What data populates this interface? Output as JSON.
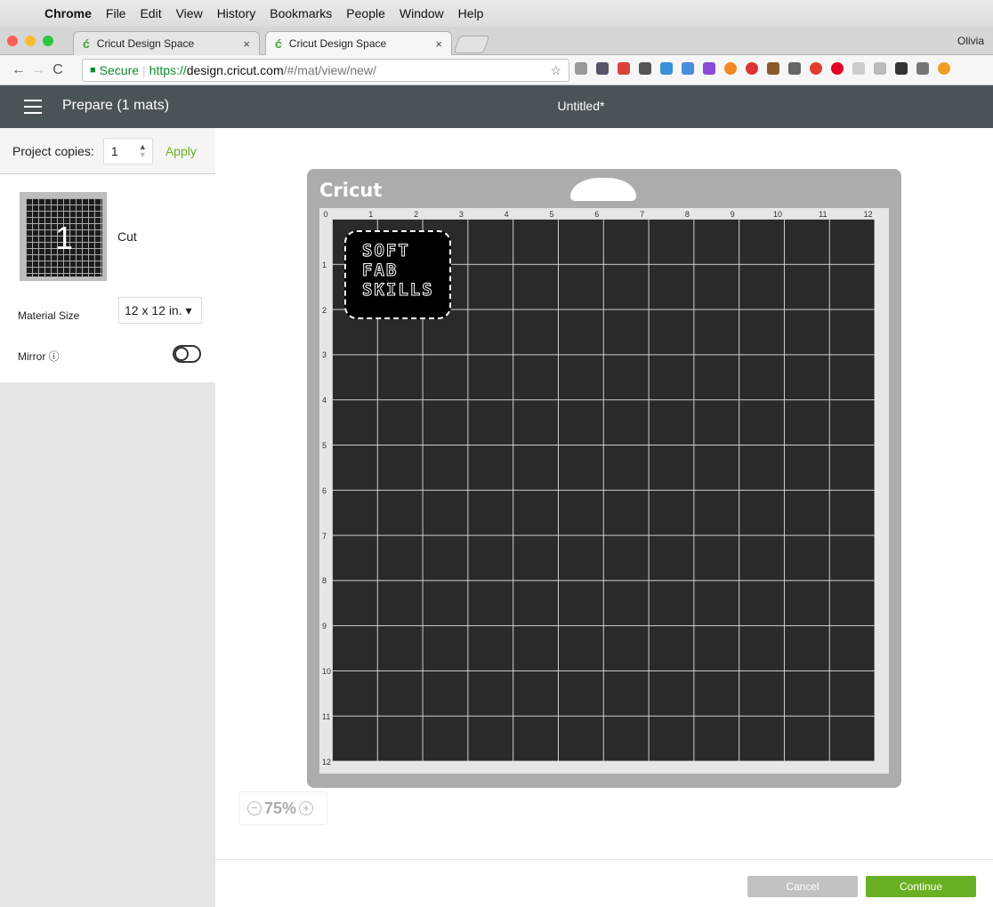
{
  "macmenu": {
    "apple": "",
    "items": [
      "Chrome",
      "File",
      "Edit",
      "View",
      "History",
      "Bookmarks",
      "People",
      "Window",
      "Help"
    ]
  },
  "browser": {
    "tabs": [
      {
        "label": "Cricut Design Space",
        "close": "×"
      },
      {
        "label": "Cricut Design Space",
        "close": "×"
      }
    ],
    "profile": "Olivia",
    "secure_label": "Secure",
    "url_scheme": "https://",
    "url_domain": "design.cricut.com",
    "url_path": "/#/mat/view/new/"
  },
  "app": {
    "prepare_title": "Prepare (1 mats)",
    "doc_title": "Untitled*"
  },
  "sidebar": {
    "copies_label": "Project copies:",
    "copies_value": "1",
    "apply_label": "Apply",
    "mat_number": "1",
    "mat_mode": "Cut",
    "material_size_label": "Material Size",
    "material_size_value": "12 x 12 in. ▾",
    "mirror_label": "Mirror ⓘ",
    "mirror_on": false
  },
  "mat": {
    "brand": "Cricut",
    "x_ticks": [
      "0",
      "1",
      "2",
      "3",
      "4",
      "5",
      "6",
      "7",
      "8",
      "9",
      "10",
      "11",
      "12"
    ],
    "y_ticks": [
      "1",
      "2",
      "3",
      "4",
      "5",
      "6",
      "7",
      "8",
      "9",
      "10",
      "11",
      "12"
    ],
    "design_lines": [
      "SOFT",
      "FAB",
      "SKILLS"
    ]
  },
  "zoom": {
    "minus": "−",
    "value": "75%",
    "plus": "+"
  },
  "footer": {
    "cancel_label": "Cancel",
    "continue_label": "Continue"
  },
  "colors": {
    "accent": "#6ab023",
    "header": "#4a5358"
  }
}
